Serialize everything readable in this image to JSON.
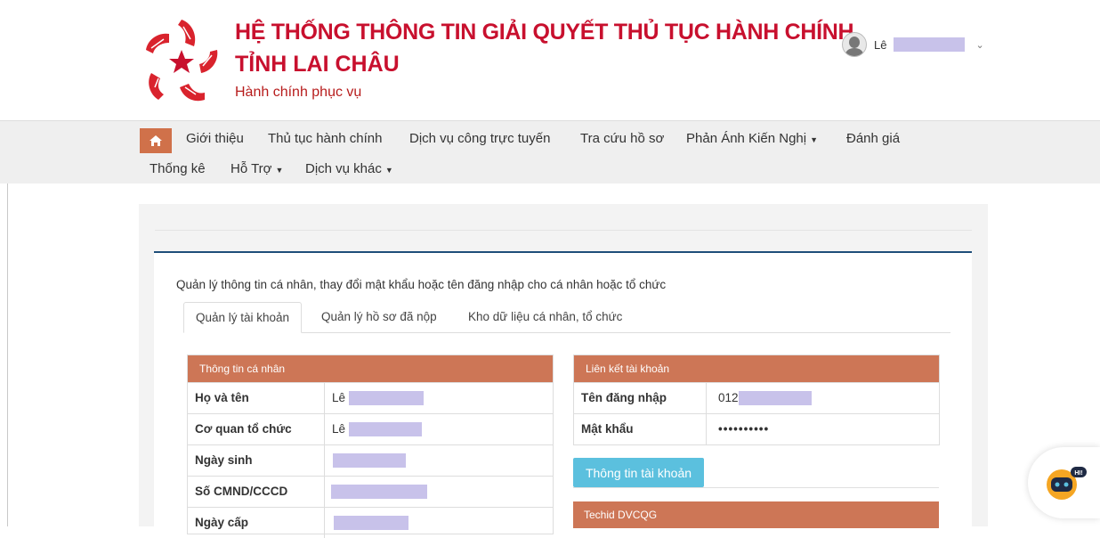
{
  "header": {
    "title": "HỆ THỐNG THÔNG TIN GIẢI QUYẾT THỦ TỤC HÀNH CHÍNH",
    "province": "TỈNH LAI CHÂU",
    "slogan": "Hành chính phục vụ",
    "user_name": "Lê",
    "logo_icon": "star-hands-logo",
    "colors": {
      "brand_red": "#c8102e",
      "accent": "#cd7656"
    }
  },
  "nav": {
    "home_icon": "home-icon",
    "items": [
      {
        "label": "Giới thiệu"
      },
      {
        "label": "Thủ tục hành chính"
      },
      {
        "label": "Dịch vụ công trực tuyến"
      },
      {
        "label": "Tra cứu hồ sơ"
      },
      {
        "label": "Phản Ánh Kiến Nghị"
      },
      {
        "label": "Đánh giá"
      },
      {
        "label": "Thống kê"
      },
      {
        "label": "Hỗ Trợ"
      },
      {
        "label": "Dịch vụ khác"
      }
    ]
  },
  "main": {
    "intro": "Quản lý thông tin cá nhân, thay đổi mật khẩu hoặc tên đăng nhập cho cá nhân hoặc tổ chức",
    "tabs": [
      {
        "label": "Quản lý tài khoản",
        "active": true
      },
      {
        "label": "Quản lý hồ sơ đã nộp",
        "active": false
      },
      {
        "label": "Kho dữ liệu cá nhân, tổ chức",
        "active": false
      }
    ],
    "personal": {
      "heading": "Thông tin cá nhân",
      "rows": [
        {
          "label": "Họ và tên",
          "value": "Lê"
        },
        {
          "label": "Cơ quan tổ chức",
          "value": "Lê"
        },
        {
          "label": "Ngày sinh",
          "value": ""
        },
        {
          "label": "Số CMND/CCCD",
          "value": ""
        },
        {
          "label": "Ngày cấp",
          "value": ""
        }
      ]
    },
    "link": {
      "heading": "Liên kết tài khoản",
      "rows": [
        {
          "label": "Tên đăng nhập",
          "value": "012"
        },
        {
          "label": "Mật khẩu",
          "value": "••••••••••"
        }
      ],
      "button": "Thông tin tài khoản"
    },
    "techid_heading": "Techid DVCQG"
  },
  "chatbot": {
    "icon": "chatbot-icon",
    "badge": "HI!"
  }
}
